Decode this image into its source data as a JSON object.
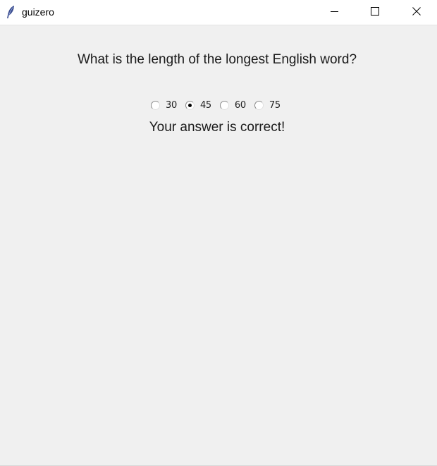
{
  "window": {
    "title": "guizero",
    "icon": "feather-icon",
    "controls": [
      "minimize-icon",
      "maximize-icon",
      "close-icon"
    ]
  },
  "question": "What is the length of the longest English word?",
  "options": [
    {
      "label": "30",
      "selected": false
    },
    {
      "label": "45",
      "selected": true
    },
    {
      "label": "60",
      "selected": false
    },
    {
      "label": "75",
      "selected": false
    }
  ],
  "result": "Your answer is correct!"
}
